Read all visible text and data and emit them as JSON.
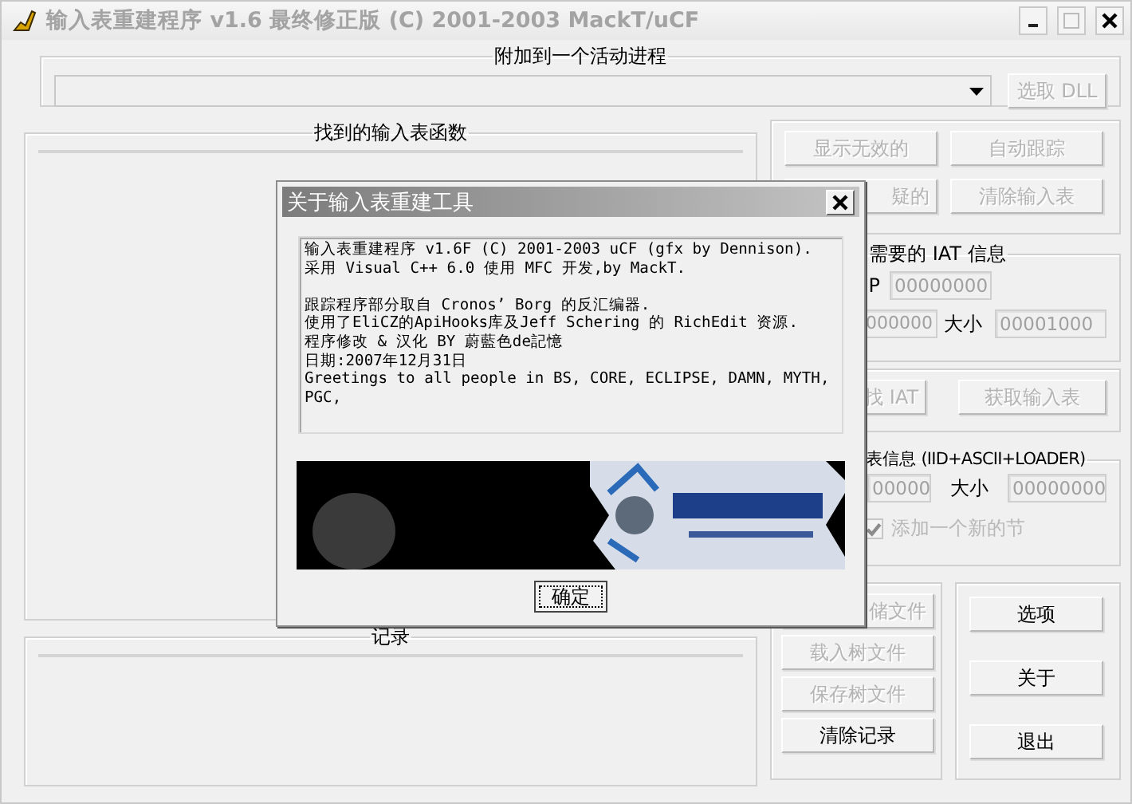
{
  "window": {
    "title": "输入表重建程序 v1.6 最终修正版 (C) 2001-2003 MackT/uCF"
  },
  "attach": {
    "label": "附加到一个活动进程",
    "button": {
      "label": "选取 DLL",
      "disabled": true
    }
  },
  "imports": {
    "label": "找到的输入表函数"
  },
  "actions": [
    {
      "label": "显示无效的",
      "disabled": true
    },
    {
      "label": "自动跟踪",
      "disabled": true
    },
    {
      "label": "疑的",
      "disabled": true
    },
    {
      "label": "清除输入表",
      "disabled": true
    }
  ],
  "iat": {
    "label": "需要的 IAT 信息",
    "oep_label": "P",
    "oep": "00000000",
    "rva": "000000",
    "size_label": "大小",
    "size": "00001000"
  },
  "iat_buttons": [
    {
      "label": "找 IAT",
      "disabled": true
    },
    {
      "label": "获取输入表",
      "disabled": true
    }
  ],
  "import_info": {
    "label": "表信息 (IID+ASCII+LOADER)",
    "rva": "00000",
    "size_label": "大小",
    "size": "00000000",
    "add_section": {
      "label": "添加一个新的节",
      "checked": true,
      "disabled": true
    }
  },
  "tree_buttons": [
    {
      "label": "储文件",
      "disabled": true
    },
    {
      "label": "载入树文件",
      "disabled": true
    },
    {
      "label": "保存树文件",
      "disabled": true
    },
    {
      "label": "清除记录",
      "disabled": false
    }
  ],
  "main_buttons": [
    {
      "label": "选项"
    },
    {
      "label": "关于"
    },
    {
      "label": "退出"
    }
  ],
  "log": {
    "label": "记录"
  },
  "about_dialog": {
    "title": "关于输入表重建工具",
    "paragraphs": [
      [
        "输入表重建程序 v1.6F (C) 2001-2003 uCF (gfx by Dennison).",
        "采用 Visual C++ 6.0 使用 MFC 开发,by MackT."
      ],
      [
        "跟踪程序部分取自 Cronos’ Borg 的反汇编器.",
        "使用了EliCZ的ApiHooks库及Jeff Schering 的 RichEdit 资源.",
        "程序修改 & 汉化 BY 蔚藍色de記憶",
        "日期:2007年12月31日",
        "Greetings to all people in BS, CORE, ECLIPSE, DAMN, MYTH, PGC,"
      ]
    ],
    "ok": "确定"
  }
}
